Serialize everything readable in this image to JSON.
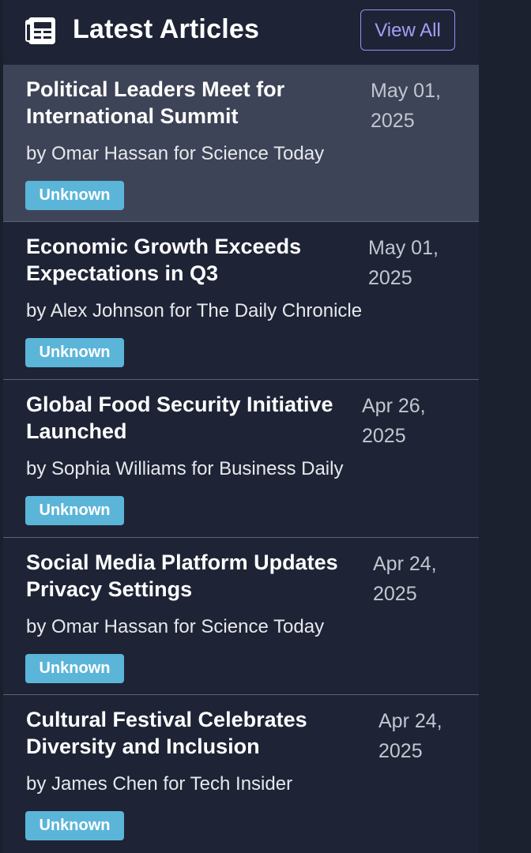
{
  "header": {
    "title": "Latest Articles",
    "view_all_label": "View All",
    "icon": "newspaper-icon"
  },
  "articles": [
    {
      "title": "Political Leaders Meet for International Summit",
      "date": "May 01, 2025",
      "byline": "by Omar Hassan for Science Today",
      "badge": "Unknown"
    },
    {
      "title": "Economic Growth Exceeds Expectations in Q3",
      "date": "May 01, 2025",
      "byline": "by Alex Johnson for The Daily Chronicle",
      "badge": "Unknown"
    },
    {
      "title": "Global Food Security Initiative Launched",
      "date": "Apr 26, 2025",
      "byline": "by Sophia Williams for Business Daily",
      "badge": "Unknown"
    },
    {
      "title": "Social Media Platform Updates Privacy Settings",
      "date": "Apr 24, 2025",
      "byline": "by Omar Hassan for Science Today",
      "badge": "Unknown"
    },
    {
      "title": "Cultural Festival Celebrates Diversity and Inclusion",
      "date": "Apr 24, 2025",
      "byline": "by James Chen for Tech Insider",
      "badge": "Unknown"
    }
  ],
  "colors": {
    "background": "#1e2435",
    "hover_row": "#3e4457",
    "accent": "#9c8cf0",
    "badge": "#5bb5d9"
  }
}
